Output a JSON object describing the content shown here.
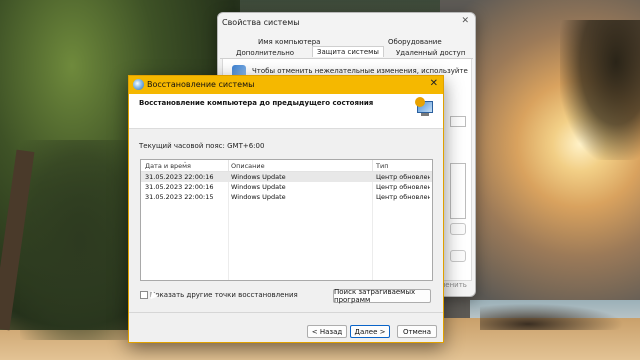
{
  "background_window": {
    "title": "Свойства системы",
    "tabs_row1": [
      "Имя компьютера",
      "Оборудование"
    ],
    "tabs_row2": [
      "Дополнительно",
      "Защита системы",
      "Удаленный доступ"
    ],
    "description": "Чтобы отменить нежелательные изменения, используйте",
    "faded_text": "менить"
  },
  "dialog": {
    "title": "Восстановление системы",
    "heading": "Восстановление компьютера до предыдущего состояния",
    "timezone": "Текущий часовой пояс: GMT+6:00",
    "columns": [
      "Дата и время",
      "Описание",
      "Тип"
    ],
    "rows": [
      {
        "date": "31.05.2023 22:00:16",
        "desc": "Windows Update",
        "type": "Центр обновлен..."
      },
      {
        "date": "31.05.2023 22:00:16",
        "desc": "Windows Update",
        "type": "Центр обновлен..."
      },
      {
        "date": "31.05.2023 22:00:15",
        "desc": "Windows Update",
        "type": "Центр обновлен..."
      }
    ],
    "show_more_label": "Показать другие точки восстановления",
    "scan_button": "Поиск затрагиваемых программ",
    "back_button": "< Назад",
    "next_button": "Далее >",
    "cancel_button": "Отмена"
  },
  "colors": {
    "dialog_titlebar": "#f5b800",
    "primary_button_border": "#0a64c8"
  }
}
